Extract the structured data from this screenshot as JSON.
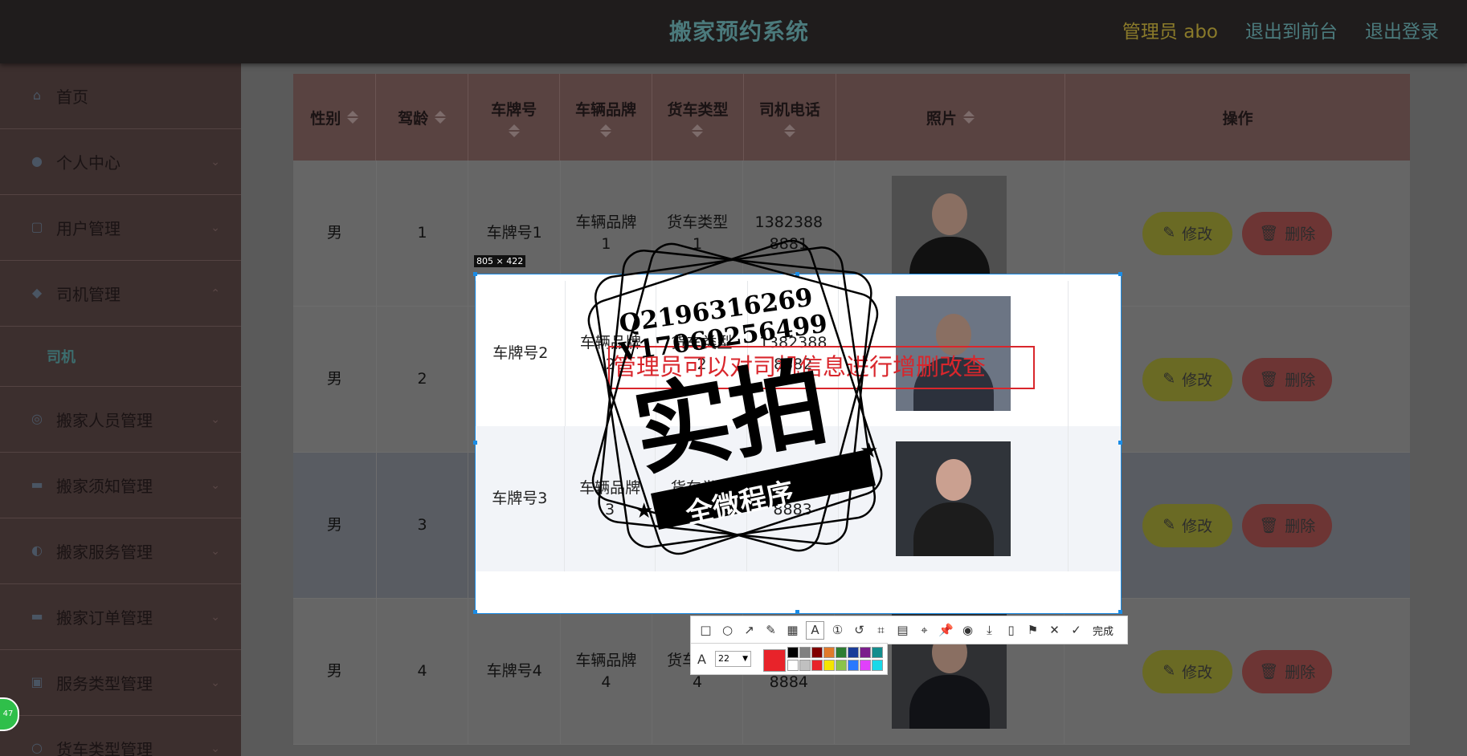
{
  "header": {
    "title": "搬家预约系统",
    "admin_label": "管理员 abo",
    "to_front_label": "退出到前台",
    "logout_label": "退出登录"
  },
  "sidebar": {
    "items": [
      {
        "label": "首页",
        "icon": "home-icon"
      },
      {
        "label": "个人中心",
        "icon": "user-icon"
      },
      {
        "label": "用户管理",
        "icon": "users-icon"
      },
      {
        "label": "司机管理",
        "icon": "truck-icon"
      },
      {
        "label": "搬家人员管理",
        "icon": "people-icon"
      },
      {
        "label": "搬家须知管理",
        "icon": "notice-icon"
      },
      {
        "label": "搬家服务管理",
        "icon": "service-icon"
      },
      {
        "label": "搬家订单管理",
        "icon": "order-icon"
      },
      {
        "label": "服务类型管理",
        "icon": "category-icon"
      },
      {
        "label": "货车类型管理",
        "icon": "van-icon"
      }
    ],
    "submenu": {
      "label": "司机"
    }
  },
  "table": {
    "headers": {
      "gender": "性别",
      "driving_age": "驾龄",
      "plate": "车牌号",
      "brand": "车辆品牌",
      "truck_type": "货车类型",
      "phone": "司机电话",
      "photo": "照片",
      "actions": "操作"
    },
    "rows": [
      {
        "gender": "男",
        "age": "1",
        "plate": "车牌号1",
        "brand": "车辆品牌1",
        "type": "货车类型1",
        "phone": "13823888881"
      },
      {
        "gender": "男",
        "age": "2",
        "plate": "车牌号2",
        "brand": "车辆品牌2",
        "type": "货车类型2",
        "phone": "13823888882"
      },
      {
        "gender": "男",
        "age": "3",
        "plate": "车牌号3",
        "brand": "车辆品牌3",
        "type": "货车类型3",
        "phone": "13823888883"
      },
      {
        "gender": "男",
        "age": "4",
        "plate": "车牌号4",
        "brand": "车辆品牌4",
        "type": "货车类型4",
        "phone": "13823888884"
      }
    ],
    "edit_label": "修改",
    "delete_label": "删除"
  },
  "snapshot": {
    "size_label": "805 × 422",
    "annotation_text": "管理员可以对司机信息进行增删改查",
    "font_size": "22",
    "done_label": "完成"
  },
  "stamp": {
    "qq": "Q2196316269",
    "wechat": "V17060256499",
    "main": "实拍",
    "ribbon": "全微程序"
  },
  "badge": {
    "text": "47"
  },
  "colors": {
    "accent": "#4b7a7c",
    "edit_button": "#6a6a24",
    "delete_button": "#6d3534",
    "annotation": "#d9262c",
    "selection": "#1a8ce6"
  }
}
